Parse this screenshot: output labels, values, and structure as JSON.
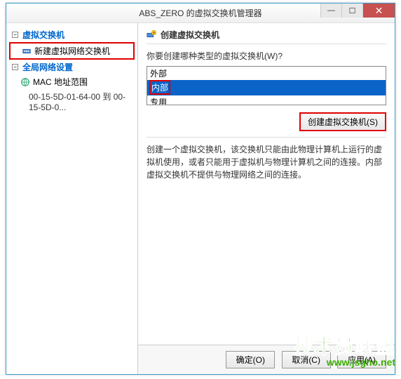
{
  "window": {
    "title": "ABS_ZERO 的虚拟交换机管理器"
  },
  "left_pane": {
    "section1": {
      "header": "虚拟交换机",
      "item": "新建虚拟网络交换机"
    },
    "section2": {
      "header": "全局网络设置",
      "item": "MAC 地址范围",
      "subitem": "00-15-5D-01-64-00 到 00-15-5D-0..."
    }
  },
  "right_pane": {
    "header": "创建虚拟交换机",
    "prompt": "你要创建哪种类型的虚拟交换机(W)?",
    "options": [
      "外部",
      "内部",
      "专用"
    ],
    "selected_index": 1,
    "create_button": "创建虚拟交换机(S)",
    "description": "创建一个虚拟交换机，该交换机只能由此物理计算机上运行的虚拟机使用，或者只能用于虚拟机与物理计算机之间的连接。内部虚拟交换机不提供与物理网络之间的连接。"
  },
  "bottom": {
    "ok": "确定(O)",
    "cancel": "取消(C)",
    "apply": "应用(A)"
  },
  "watermark": {
    "main": "技术员联盟",
    "sub": "www.jsgho.net"
  }
}
